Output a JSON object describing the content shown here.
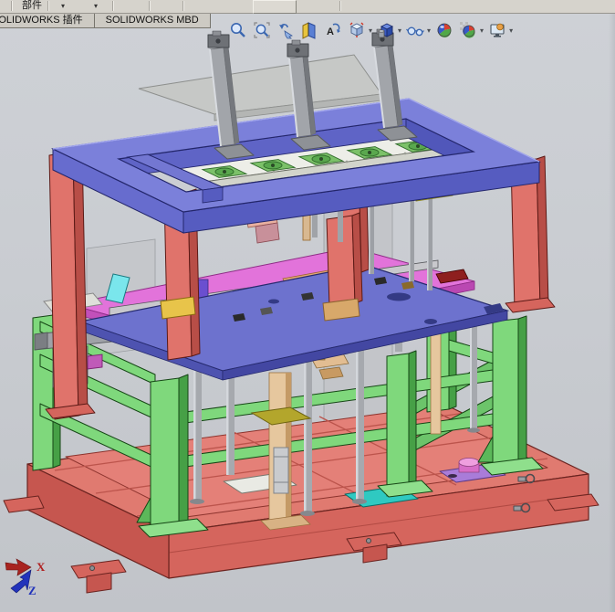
{
  "menu_bar": {
    "component_tab_label": "部件",
    "dropdown_arrow": "▾",
    "blank_button": ""
  },
  "command_tabs": [
    {
      "label": "SOLIDWORKS 插件"
    },
    {
      "label": "SOLIDWORKS MBD"
    }
  ],
  "headsup_toolbar": {
    "buttons": [
      {
        "name": "zoom-to-fit",
        "dropdown": false
      },
      {
        "name": "zoom-to-area",
        "dropdown": false
      },
      {
        "name": "previous-view",
        "dropdown": false
      },
      {
        "name": "section-view",
        "dropdown": false
      },
      {
        "name": "dynamic-annotation-views",
        "dropdown": false
      },
      {
        "name": "view-orientation",
        "dropdown": true
      },
      {
        "name": "display-style",
        "dropdown": true
      },
      {
        "name": "hide-show-items",
        "dropdown": true
      },
      {
        "name": "edit-appearance",
        "dropdown": false
      },
      {
        "name": "apply-scene",
        "dropdown": true
      },
      {
        "name": "view-settings",
        "dropdown": true
      }
    ]
  },
  "viewport": {
    "triad": {
      "x": "X",
      "z": "Z"
    },
    "colors": {
      "base_red": "#e07a70",
      "column_red": "#e0736b",
      "frame_green": "#7fd87c",
      "top_frame_purple": "#7b80da",
      "mid_plate_slate": "#6d72ce",
      "pink_plate": "#e273da",
      "top_plate_white": "#edeee8",
      "pad_green": "#7cc169",
      "accent_cyan": "#2fc9c1",
      "accent_yellow": "#ded23f",
      "rod_gray": "#a6a9ae",
      "rod_tan": "#e6c79e",
      "background_gray": "#c9ccd1"
    }
  }
}
